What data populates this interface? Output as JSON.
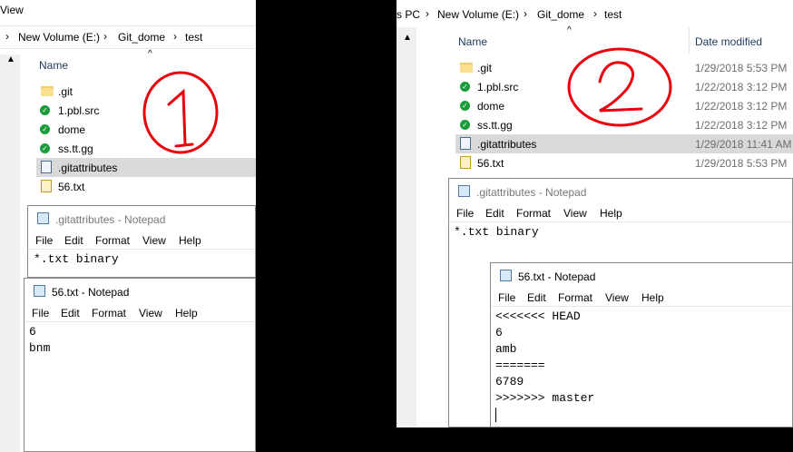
{
  "left": {
    "menu_view": "View",
    "breadcrumb": [
      "New Volume (E:)",
      "Git_dome",
      "test"
    ],
    "col_name": "Name",
    "files": [
      ".git",
      "1.pbl.src",
      "dome",
      "ss.tt.gg",
      ".gitattributes",
      "56.txt"
    ],
    "notepad_attr": {
      "title": ".gitattributes - Notepad",
      "content": [
        "*.txt binary"
      ]
    },
    "notepad_56": {
      "title": "56.txt - Notepad",
      "content": [
        "6",
        "bnm"
      ]
    },
    "annotation": "1"
  },
  "right": {
    "breadcrumb_prefix": "s PC",
    "breadcrumb": [
      "New Volume (E:)",
      "Git_dome",
      "test"
    ],
    "col_name": "Name",
    "col_date": "Date modified",
    "files": [
      {
        "name": ".git",
        "date": "1/29/2018 5:53 PM"
      },
      {
        "name": "1.pbl.src",
        "date": "1/22/2018 3:12 PM"
      },
      {
        "name": "dome",
        "date": "1/22/2018 3:12 PM"
      },
      {
        "name": "ss.tt.gg",
        "date": "1/22/2018 3:12 PM"
      },
      {
        "name": ".gitattributes",
        "date": "1/29/2018 11:41 AM"
      },
      {
        "name": "56.txt",
        "date": "1/29/2018 5:53 PM"
      }
    ],
    "notepad_attr": {
      "title": ".gitattributes - Notepad",
      "content": [
        "*.txt binary"
      ]
    },
    "notepad_56": {
      "title": "56.txt - Notepad",
      "content": [
        "<<<<<<< HEAD",
        "6",
        "amb",
        "=======",
        "6789",
        ">>>>>>> master"
      ]
    },
    "annotation": "2"
  },
  "menu": [
    "File",
    "Edit",
    "Format",
    "View",
    "Help"
  ],
  "colors": {
    "selection": "#d9d9d9",
    "annotation": "#e8000b",
    "header_text": "#1e395b"
  }
}
